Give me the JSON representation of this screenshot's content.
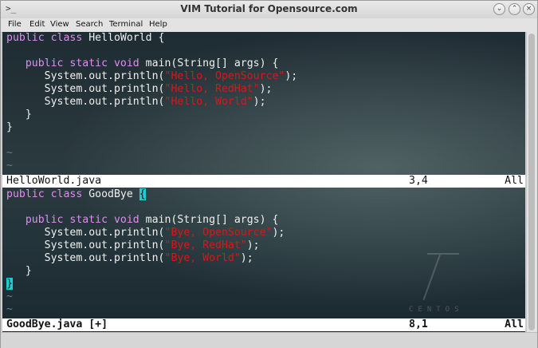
{
  "window": {
    "title": "VIM Tutorial for Opensource.com",
    "app_icon": "terminal-icon",
    "buttons": [
      "minimize",
      "maximize",
      "close"
    ]
  },
  "menu": [
    "File",
    "Edit",
    "View",
    "Search",
    "Terminal",
    "Help"
  ],
  "colors": {
    "keyword": "#e08df0",
    "string": "#dd1515",
    "tilde": "#5a7fa0",
    "cursor": "#1ccfd0",
    "status_bg": "#ffffff"
  },
  "top_pane": {
    "code": {
      "l1_kw": "public class ",
      "l1_text": "HelloWorld {",
      "l3_kw": "   public static void ",
      "l3_text": "main(String[] args) {",
      "l4_pre": "      System.out.println(",
      "l4_str": "\"Hello, OpenSource\"",
      "l4_post": ");",
      "l5_pre": "      System.out.println(",
      "l5_str": "\"Hello, RedHat\"",
      "l5_post": ");",
      "l6_pre": "      System.out.println(",
      "l6_str": "\"Hello, World\"",
      "l6_post": ");",
      "l7": "   }",
      "l8": "}",
      "tilde": "~"
    },
    "status": {
      "filename": "HelloWorld.java",
      "position": "3,4",
      "scroll": "All"
    }
  },
  "bottom_pane": {
    "code": {
      "l1_kw": "public class ",
      "l1_text": "GoodBye ",
      "l1_cursor": "{",
      "l3_kw": "   public static void ",
      "l3_text": "main(String[] args) {",
      "l4_pre": "      System.out.println(",
      "l4_str": "\"Bye, OpenSource\"",
      "l4_post": ");",
      "l5_pre": "      System.out.println(",
      "l5_str": "\"Bye, RedHat\"",
      "l5_post": ");",
      "l6_pre": "      System.out.println(",
      "l6_str": "\"Bye, World\"",
      "l6_post": ");",
      "l7": "   }",
      "l8_cursor": "}",
      "tilde": "~"
    },
    "status": {
      "filename": "GoodBye.java [+]",
      "position": "8,1",
      "scroll": "All"
    }
  },
  "watermark": {
    "numeral": "7",
    "text": "CENTOS"
  }
}
